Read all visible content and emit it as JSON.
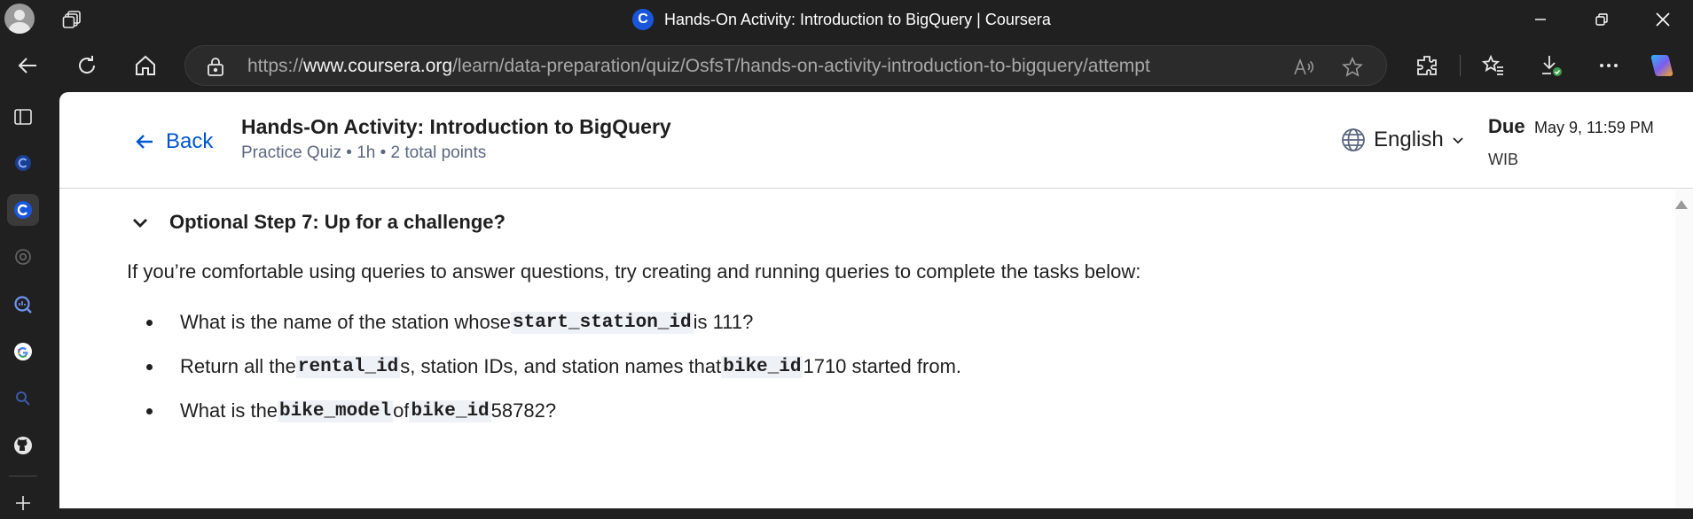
{
  "window": {
    "title": "Hands-On Activity: Introduction to BigQuery | Coursera",
    "favicon_letter": "C"
  },
  "browser": {
    "url_prefix": "https://",
    "url_host": "www.coursera.org",
    "url_path": "/learn/data-preparation/quiz/OsfsT/hands-on-activity-introduction-to-bigquery/attempt"
  },
  "header": {
    "back_label": "Back",
    "quiz_title": "Hands-On Activity: Introduction to BigQuery",
    "quiz_subtitle": "Practice Quiz • 1h • 2 total points",
    "language": "English",
    "due_label": "Due",
    "due_date": "May 9, 11:59 PM",
    "due_timezone": "WIB"
  },
  "section": {
    "step_title": "Optional Step 7: Up for a challenge?",
    "intro": "If you’re comfortable using queries to answer questions, try creating and running queries to complete the tasks below:",
    "bullets": [
      {
        "t1": "What is the name of the station whose ",
        "c1": "start_station_id",
        "t2": " is 111?"
      },
      {
        "t1": "Return all the ",
        "c1": "rental_id",
        "t2": "s, station IDs, and station names that ",
        "c2": "bike_id",
        "t3": " 1710 started from."
      },
      {
        "t1": "What is the ",
        "c1": "bike_model",
        "t2": " of ",
        "c2": "bike_id",
        "t3": " 58782?"
      }
    ]
  },
  "colors": {
    "accent": "#0056d2",
    "chrome_bg": "#202020",
    "code_bg": "#eef1f6"
  }
}
